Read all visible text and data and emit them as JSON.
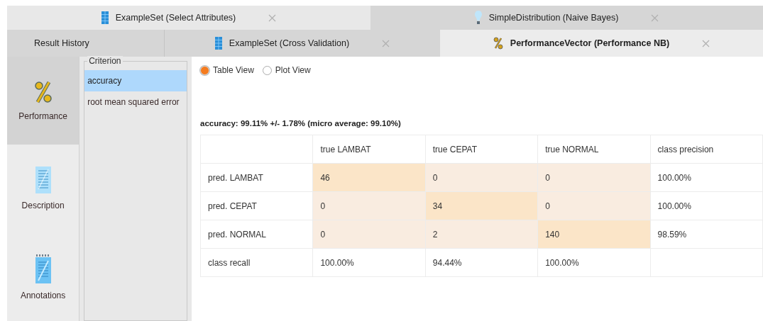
{
  "tab_rows": [
    {
      "tabs": [
        {
          "label": "ExampleSet (Select Attributes)",
          "kind": "table",
          "selected": false
        },
        {
          "label": "SimpleDistribution (Naive Bayes)",
          "kind": "model",
          "selected": false
        }
      ]
    },
    {
      "tabs": [
        {
          "label": "Result History",
          "kind": "history",
          "selected": false
        },
        {
          "label": "ExampleSet (Cross Validation)",
          "kind": "table",
          "selected": false
        },
        {
          "label": "PerformanceVector (Performance NB)",
          "kind": "performance",
          "selected": true
        }
      ]
    }
  ],
  "sidebar": {
    "items": [
      {
        "label": "Performance",
        "kind": "performance",
        "selected": true
      },
      {
        "label": "Description",
        "kind": "description",
        "selected": false
      },
      {
        "label": "Annotations",
        "kind": "annotations",
        "selected": false
      }
    ]
  },
  "criterion": {
    "title": "Criterion",
    "items": [
      {
        "label": "accuracy",
        "selected": true
      },
      {
        "label": "root mean squared error",
        "selected": false
      }
    ]
  },
  "view_options": [
    {
      "label": "Table View",
      "selected": true
    },
    {
      "label": "Plot View",
      "selected": false
    }
  ],
  "summary": "accuracy: 99.11% +/- 1.78% (micro average: 99.10%)",
  "table": {
    "columns": [
      "",
      "true LAMBAT",
      "true CEPAT",
      "true NORMAL",
      "class precision"
    ],
    "rows": [
      {
        "cells": [
          {
            "text": "pred. LAMBAT",
            "kind": "label"
          },
          {
            "text": "46",
            "kind": "diagonal"
          },
          {
            "text": "0",
            "kind": "count"
          },
          {
            "text": "0",
            "kind": "count"
          },
          {
            "text": "100.00%",
            "kind": "label"
          }
        ]
      },
      {
        "cells": [
          {
            "text": "pred. CEPAT",
            "kind": "label"
          },
          {
            "text": "0",
            "kind": "count"
          },
          {
            "text": "34",
            "kind": "diagonal"
          },
          {
            "text": "0",
            "kind": "count"
          },
          {
            "text": "100.00%",
            "kind": "label"
          }
        ]
      },
      {
        "cells": [
          {
            "text": "pred. NORMAL",
            "kind": "label"
          },
          {
            "text": "0",
            "kind": "count"
          },
          {
            "text": "2",
            "kind": "count"
          },
          {
            "text": "140",
            "kind": "diagonal"
          },
          {
            "text": "98.59%",
            "kind": "label"
          }
        ]
      },
      {
        "cells": [
          {
            "text": "class recall",
            "kind": "label"
          },
          {
            "text": "100.00%",
            "kind": "label"
          },
          {
            "text": "94.44%",
            "kind": "label"
          },
          {
            "text": "100.00%",
            "kind": "label"
          },
          {
            "text": "",
            "kind": "label"
          }
        ]
      }
    ]
  }
}
